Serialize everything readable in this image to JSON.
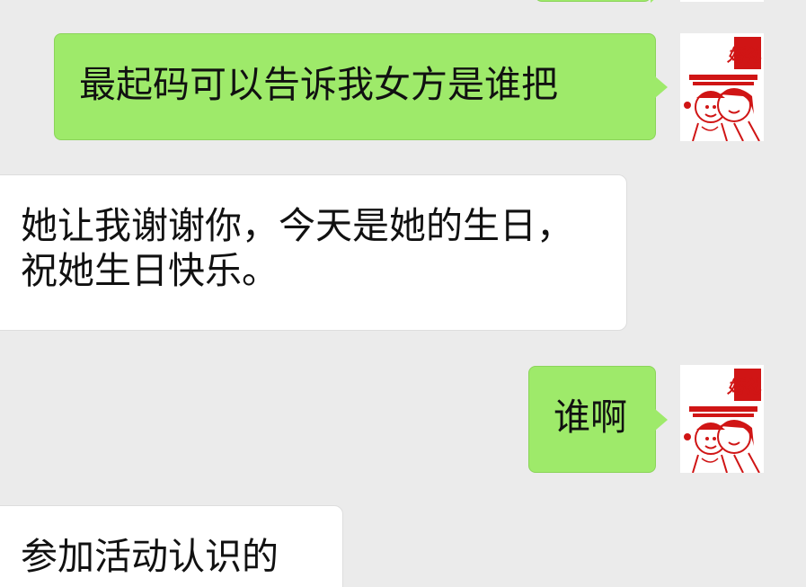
{
  "chat": {
    "messages": [
      {
        "sender": "me",
        "text": "最起码可以告诉我女方是谁把"
      },
      {
        "sender": "other",
        "text": "她让我谢谢你，今天是她的生日，祝她生日快乐。"
      },
      {
        "sender": "me",
        "text": "谁啊"
      },
      {
        "sender": "other",
        "text": "参加活动认识的"
      }
    ],
    "avatar": {
      "label": "婚礼"
    }
  },
  "colors": {
    "background": "#ebebeb",
    "sent_bubble": "#9eea6a",
    "received_bubble": "#ffffff",
    "avatar_red": "#d01515"
  },
  "icons": {
    "avatar": "wedding-couple-avatar"
  }
}
